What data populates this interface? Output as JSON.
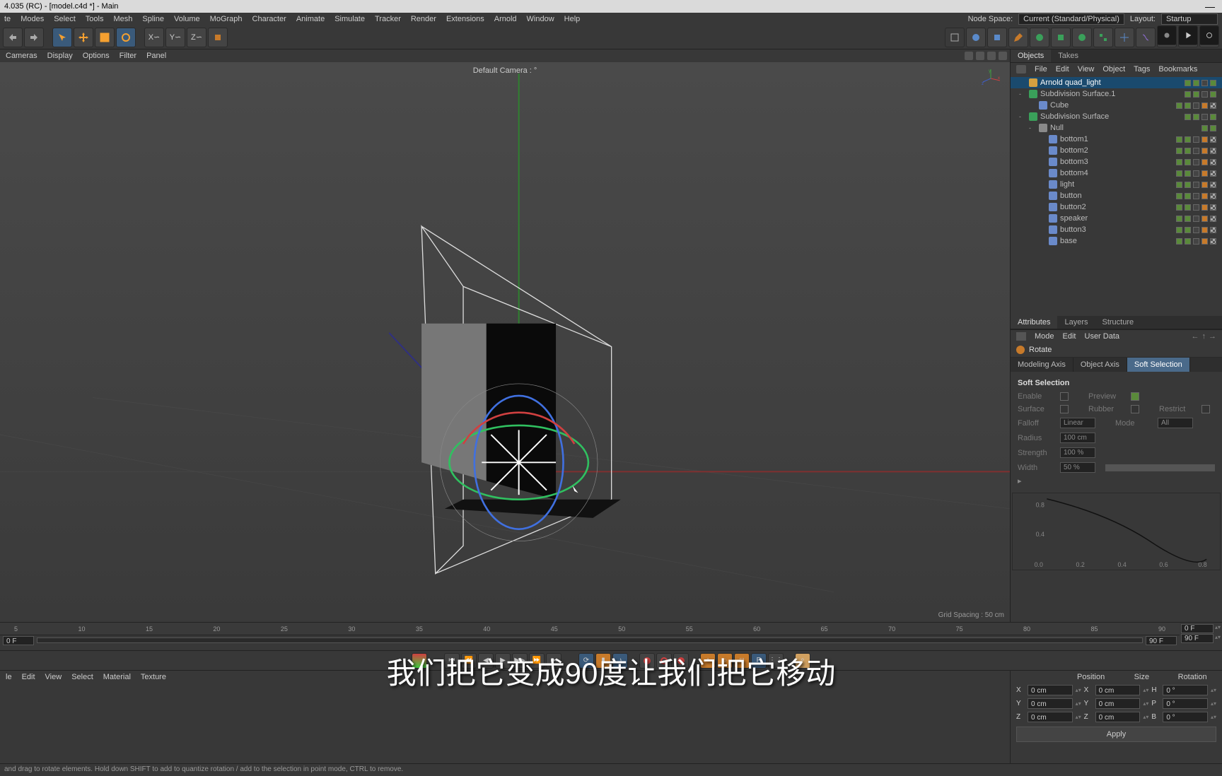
{
  "title": "4.035 (RC) - [model.c4d *] - Main",
  "menubar": [
    "te",
    "Modes",
    "Select",
    "Tools",
    "Mesh",
    "Spline",
    "Volume",
    "MoGraph",
    "Character",
    "Animate",
    "Simulate",
    "Tracker",
    "Render",
    "Extensions",
    "Arnold",
    "Window",
    "Help"
  ],
  "menubar_right": {
    "nodespace": "Node Space:",
    "nodespace_val": "Current (Standard/Physical)",
    "layout": "Layout:",
    "layout_val": "Startup"
  },
  "vp_menu": [
    "Cameras",
    "Display",
    "Options",
    "Filter",
    "Panel"
  ],
  "cam_label": "Default Camera : °",
  "grid_label": "Grid Spacing : 50 cm",
  "objects_tabs": [
    "Objects",
    "Takes"
  ],
  "om_menu": [
    "File",
    "Edit",
    "View",
    "Object",
    "Tags",
    "Bookmarks"
  ],
  "tree": [
    {
      "name": "Arnold quad_light",
      "depth": 0,
      "sel": true,
      "ico": "#d4a040",
      "dots": [
        "g",
        "g",
        "",
        "g"
      ]
    },
    {
      "name": "Subdivision Surface.1",
      "depth": 0,
      "exp": "-",
      "ico": "#3aa05a",
      "dots": [
        "g",
        "g",
        "",
        "g"
      ]
    },
    {
      "name": "Cube",
      "depth": 1,
      "ico": "#6a8aca",
      "dots": [
        "g",
        "g",
        "",
        "o",
        "chk"
      ]
    },
    {
      "name": "Subdivision Surface",
      "depth": 0,
      "exp": "-",
      "ico": "#3aa05a",
      "dots": [
        "g",
        "g",
        "",
        "g"
      ]
    },
    {
      "name": "Null",
      "depth": 1,
      "exp": "-",
      "ico": "#8a8a8a",
      "dots": [
        "g",
        "g"
      ]
    },
    {
      "name": "bottom1",
      "depth": 2,
      "ico": "#6a8aca",
      "dots": [
        "g",
        "g",
        "",
        "o",
        "chk"
      ]
    },
    {
      "name": "bottom2",
      "depth": 2,
      "ico": "#6a8aca",
      "dots": [
        "g",
        "g",
        "",
        "o",
        "chk"
      ]
    },
    {
      "name": "bottom3",
      "depth": 2,
      "ico": "#6a8aca",
      "dots": [
        "g",
        "g",
        "",
        "o",
        "chk"
      ]
    },
    {
      "name": "bottom4",
      "depth": 2,
      "ico": "#6a8aca",
      "dots": [
        "g",
        "g",
        "",
        "o",
        "chk"
      ]
    },
    {
      "name": "light",
      "depth": 2,
      "ico": "#6a8aca",
      "dots": [
        "g",
        "g",
        "",
        "o",
        "chk"
      ]
    },
    {
      "name": "button",
      "depth": 2,
      "ico": "#6a8aca",
      "dots": [
        "g",
        "g",
        "",
        "o",
        "chk"
      ]
    },
    {
      "name": "button2",
      "depth": 2,
      "ico": "#6a8aca",
      "dots": [
        "g",
        "g",
        "",
        "o",
        "chk"
      ]
    },
    {
      "name": "speaker",
      "depth": 2,
      "ico": "#6a8aca",
      "dots": [
        "g",
        "g",
        "",
        "o",
        "chk"
      ]
    },
    {
      "name": "button3",
      "depth": 2,
      "ico": "#6a8aca",
      "dots": [
        "g",
        "g",
        "",
        "o",
        "chk"
      ]
    },
    {
      "name": "base",
      "depth": 2,
      "ico": "#6a8aca",
      "dots": [
        "g",
        "g",
        "",
        "o",
        "chk"
      ]
    }
  ],
  "attr_tabs": [
    "Attributes",
    "Layers",
    "Structure"
  ],
  "attr_menu": [
    "Mode",
    "Edit",
    "User Data"
  ],
  "attr_title": "Rotate",
  "subtabs": [
    "Modeling Axis",
    "Object Axis",
    "Soft Selection"
  ],
  "soft": {
    "title": "Soft Selection",
    "enable": "Enable",
    "preview": "Preview",
    "surface": "Surface",
    "rubber": "Rubber",
    "restrict": "Restrict",
    "falloff": "Falloff",
    "falloff_v": "Linear",
    "mode": "Mode",
    "mode_v": "All",
    "radius": "Radius",
    "radius_v": "100 cm",
    "strength": "Strength",
    "strength_v": "100 %",
    "width": "Width",
    "width_v": "50 %"
  },
  "graph_ticks_y": [
    "0.8",
    "0.4"
  ],
  "graph_ticks_x": [
    "0.0",
    "0.2",
    "0.4",
    "0.6",
    "0.8"
  ],
  "ruler": [
    "5",
    "10",
    "15",
    "20",
    "25",
    "30",
    "35",
    "40",
    "45",
    "50",
    "55",
    "60",
    "65",
    "70",
    "75",
    "80",
    "85",
    "90"
  ],
  "time_start": "0 F",
  "time_end": "90 F",
  "time_r1": "0 F",
  "time_r2": "90 F",
  "mat_menu": [
    "le",
    "Edit",
    "View",
    "Select",
    "Material",
    "Texture"
  ],
  "coord": {
    "pos": "Position",
    "size": "Size",
    "rot": "Rotation",
    "x": "X",
    "y": "Y",
    "z": "Z",
    "h": "H",
    "p": "P",
    "b": "B",
    "sx": "X",
    "sy": "Y",
    "sz": "Z",
    "px": "0 cm",
    "py": "0 cm",
    "pz": "0 cm",
    "szx": "0 cm",
    "szy": "0 cm",
    "szz": "0 cm",
    "rh": "0 °",
    "rp": "0 °",
    "rb": "0 °",
    "apply": "Apply"
  },
  "status": "and drag to rotate elements. Hold down SHIFT to add to quantize rotation / add to the selection in point mode, CTRL to remove.",
  "subtitle": "我们把它变成90度让我们把它移动"
}
